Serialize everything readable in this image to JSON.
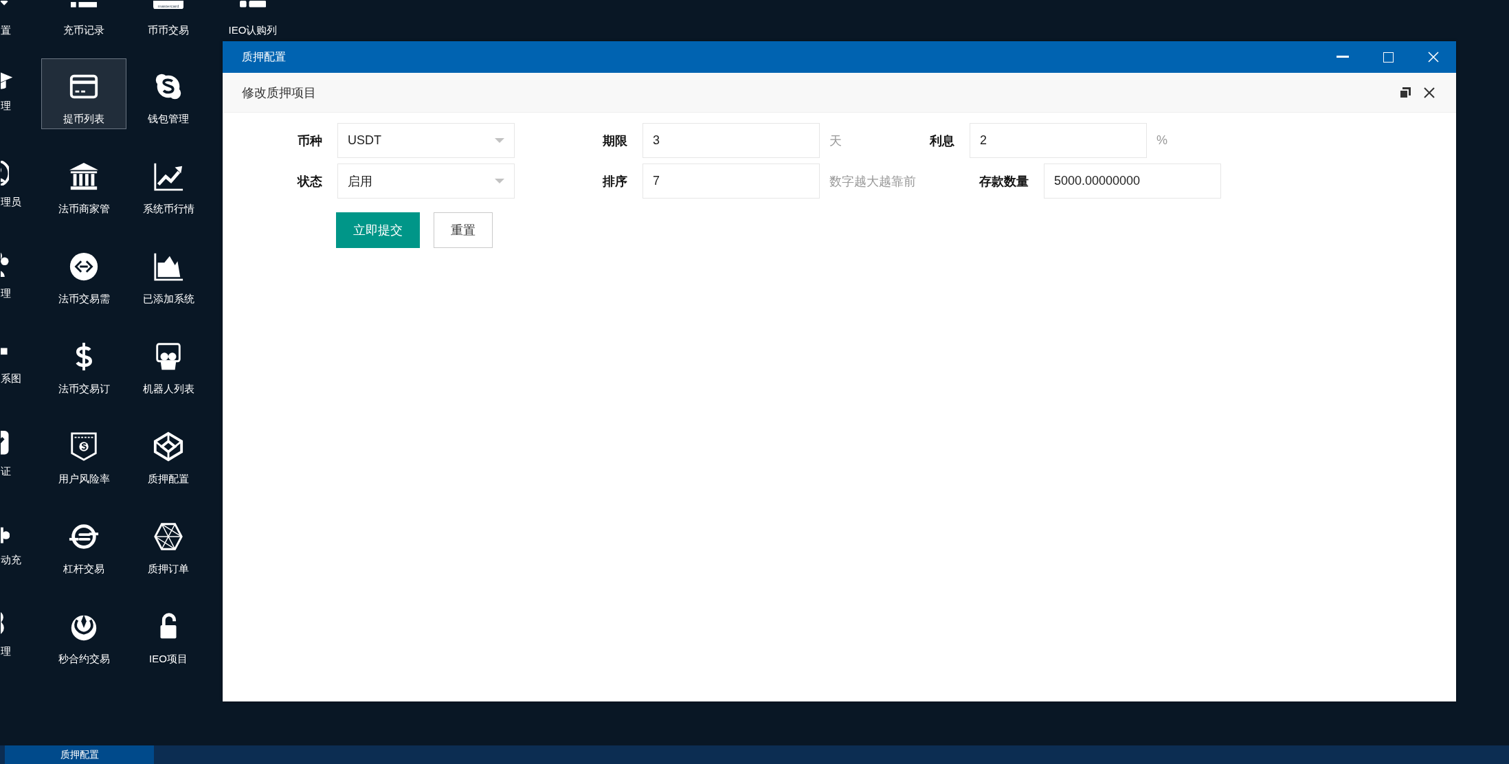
{
  "desktop": {
    "rows": [
      [
        {
          "label": "置",
          "selected": false
        },
        {
          "label": "充币记录",
          "selected": false
        },
        {
          "label": "币币交易",
          "selected": false,
          "icon_caption": "mastercard"
        },
        {
          "label": "IEO认购列",
          "selected": false
        }
      ],
      [
        {
          "label": "理",
          "selected": false
        },
        {
          "label": "提币列表",
          "selected": true
        },
        {
          "label": "钱包管理",
          "selected": false
        }
      ],
      [
        {
          "label": "理员",
          "selected": false
        },
        {
          "label": "法币商家管",
          "selected": false
        },
        {
          "label": "系统币行情",
          "selected": false
        }
      ],
      [
        {
          "label": "理",
          "selected": false
        },
        {
          "label": "法币交易需",
          "selected": false
        },
        {
          "label": "已添加系统",
          "selected": false
        }
      ],
      [
        {
          "label": "系图",
          "selected": false
        },
        {
          "label": "法币交易订",
          "selected": false
        },
        {
          "label": "机器人列表",
          "selected": false
        }
      ],
      [
        {
          "label": "证",
          "selected": false
        },
        {
          "label": "用户风险率",
          "selected": false
        },
        {
          "label": "质押配置",
          "selected": false
        }
      ],
      [
        {
          "label": "动充",
          "selected": false
        },
        {
          "label": "杠杆交易",
          "selected": false
        },
        {
          "label": "质押订单",
          "selected": false
        }
      ],
      [
        {
          "label": "理",
          "selected": false
        },
        {
          "label": "秒合约交易",
          "selected": false
        },
        {
          "label": "IEO项目",
          "selected": false
        }
      ]
    ]
  },
  "window": {
    "title": "质押配置",
    "subtitle": "修改质押项目",
    "form": {
      "rows": [
        [
          {
            "kind": "select",
            "label": "币种",
            "value": "USDT"
          },
          {
            "kind": "input",
            "label": "期限",
            "value": "3",
            "suffix": "天"
          },
          {
            "kind": "input",
            "label": "利息",
            "value": "2",
            "suffix": "%"
          }
        ],
        [
          {
            "kind": "select",
            "label": "状态",
            "value": "启用"
          },
          {
            "kind": "input",
            "label": "排序",
            "value": "7",
            "suffix": "数字越大越靠前"
          },
          {
            "kind": "input",
            "label": "存款数量",
            "value": "5000.00000000"
          }
        ]
      ],
      "buttons": [
        {
          "kind": "primary",
          "label": "立即提交"
        },
        {
          "kind": "secondary",
          "label": "重置"
        }
      ]
    }
  },
  "taskbar": {
    "tabs": [
      {
        "label": "质押配置",
        "selected": true
      }
    ]
  }
}
